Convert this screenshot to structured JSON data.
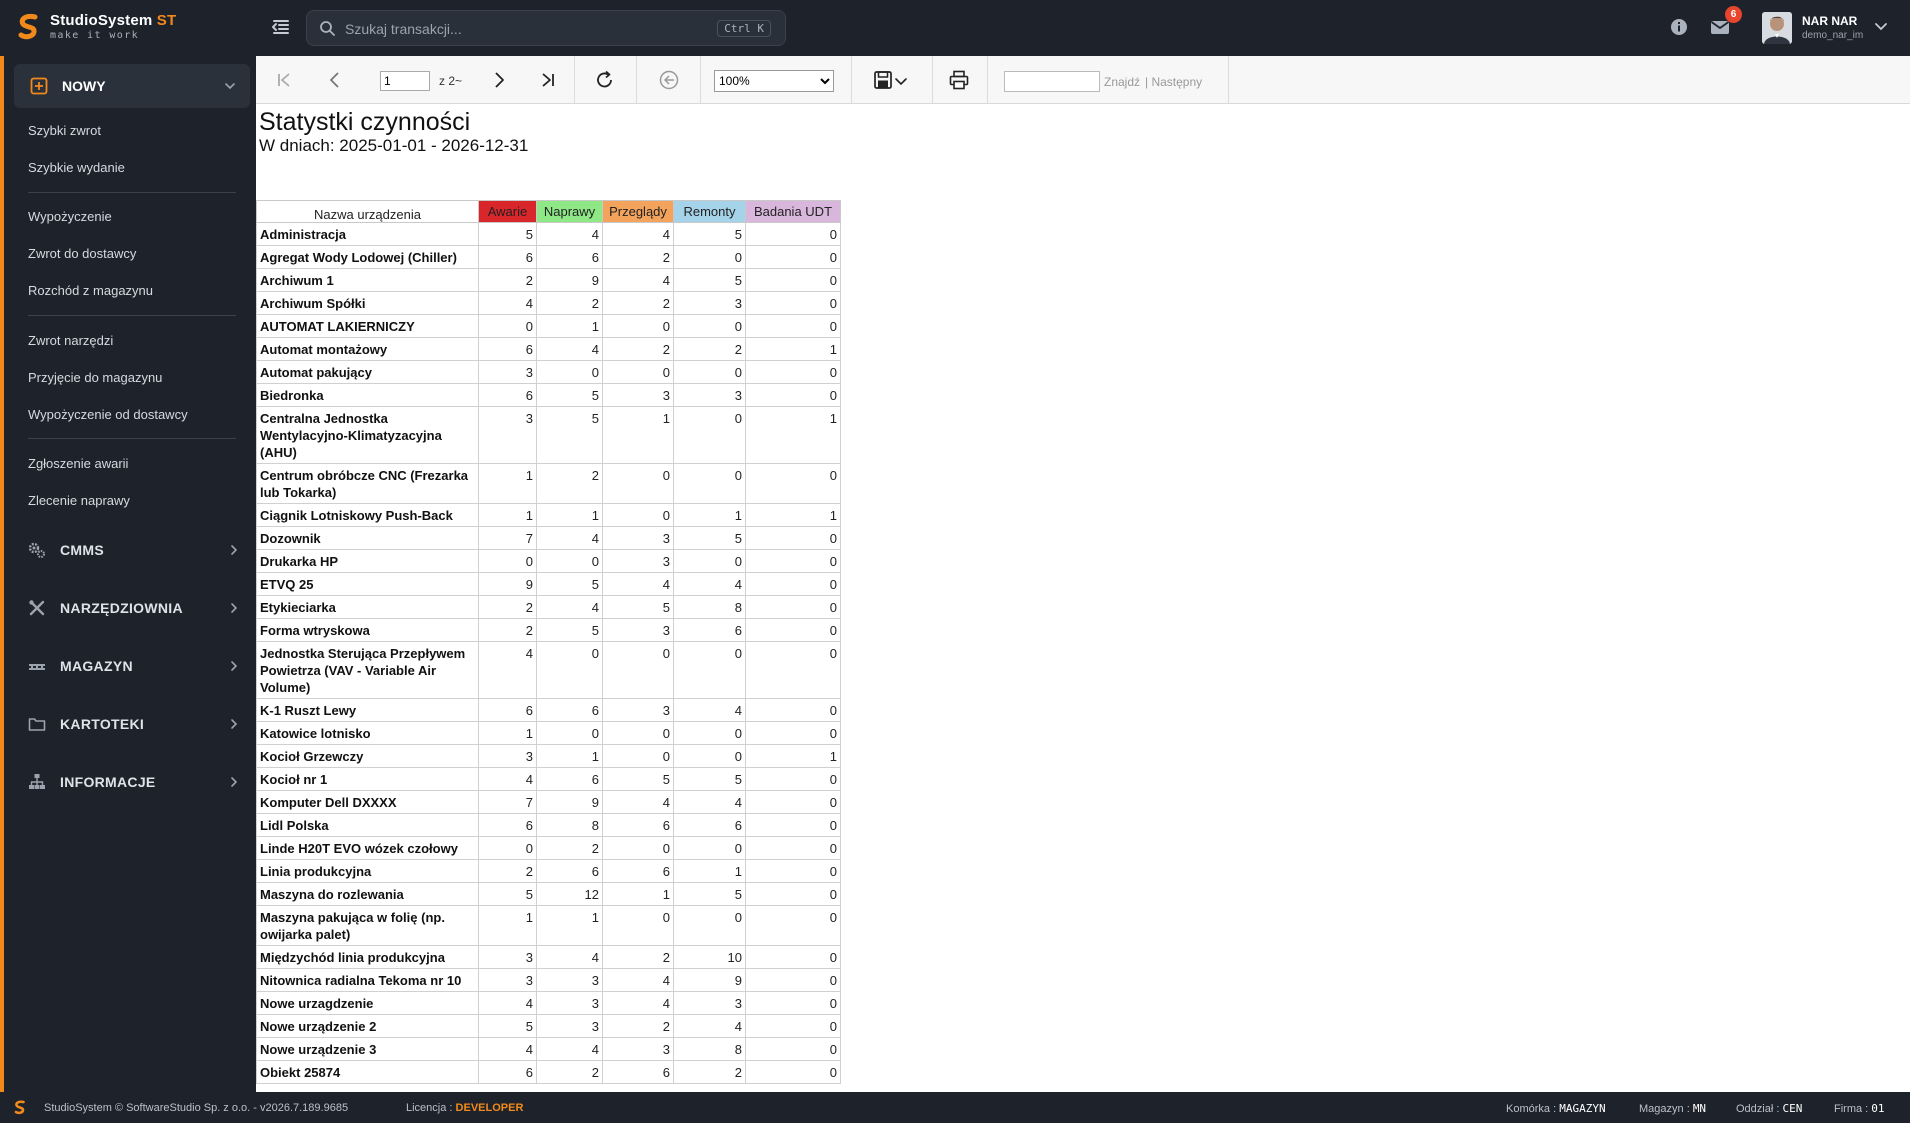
{
  "app": {
    "name": "StudioSystem",
    "name_suffix": "ST",
    "slogan": "make it work",
    "brand_color": "#f28a1b"
  },
  "header": {
    "search_placeholder": "Szukaj transakcji...",
    "search_shortcut": "Ctrl K",
    "notifications_count": "6",
    "user_name": "NAR NAR",
    "user_login": "demo_nar_im"
  },
  "sidebar": {
    "active_section": "NOWY",
    "sub_items": [
      "Szybki zwrot",
      "Szybkie wydanie",
      "Wypożyczenie",
      "Zwrot do dostawcy",
      "Rozchód z magazynu",
      "Zwrot narzędzi",
      "Przyjęcie do magazynu",
      "Wypożyczenie od dostawcy",
      "Zgłoszenie awarii",
      "Zlecenie naprawy"
    ],
    "sections": [
      "CMMS",
      "NARZĘDZIOWNIA",
      "MAGAZYN",
      "KARTOTEKI",
      "INFORMACJE"
    ]
  },
  "toolbar": {
    "page_value": "1",
    "page_of": "z 2~",
    "zoom": "100%",
    "find_label": "Znajdź",
    "next_label": "| Następny"
  },
  "report": {
    "title": "Statystki czynności",
    "subtitle": "W dniach: 2025-01-01 - 2026-12-31",
    "col_name": "Nazwa urządzenia",
    "columns": [
      {
        "label": "Awarie",
        "color": "#d9262a"
      },
      {
        "label": "Naprawy",
        "color": "#8ee886"
      },
      {
        "label": "Przeglądy",
        "color": "#f3a35c"
      },
      {
        "label": "Remonty",
        "color": "#a5d3ea"
      },
      {
        "label": "Badania UDT",
        "color": "#d9b7dd"
      }
    ],
    "rows": [
      {
        "name": "Administracja",
        "values": [
          5,
          4,
          4,
          5,
          0
        ]
      },
      {
        "name": "Agregat Wody Lodowej (Chiller)",
        "values": [
          6,
          6,
          2,
          0,
          0
        ]
      },
      {
        "name": "Archiwum 1",
        "values": [
          2,
          9,
          4,
          5,
          0
        ]
      },
      {
        "name": "Archiwum Spółki",
        "values": [
          4,
          2,
          2,
          3,
          0
        ]
      },
      {
        "name": "AUTOMAT LAKIERNICZY",
        "values": [
          0,
          1,
          0,
          0,
          0
        ]
      },
      {
        "name": "Automat montażowy",
        "values": [
          6,
          4,
          2,
          2,
          1
        ]
      },
      {
        "name": "Automat pakujący",
        "values": [
          3,
          0,
          0,
          0,
          0
        ]
      },
      {
        "name": "Biedronka",
        "values": [
          6,
          5,
          3,
          3,
          0
        ]
      },
      {
        "name": "Centralna Jednostka Wentylacyjno-Klimatyzacyjna (AHU)",
        "values": [
          3,
          5,
          1,
          0,
          1
        ]
      },
      {
        "name": "Centrum obróbcze CNC (Frezarka lub Tokarka)",
        "values": [
          1,
          2,
          0,
          0,
          0
        ]
      },
      {
        "name": "Ciągnik Lotniskowy Push-Back",
        "values": [
          1,
          1,
          0,
          1,
          1
        ]
      },
      {
        "name": "Dozownik",
        "values": [
          7,
          4,
          3,
          5,
          0
        ]
      },
      {
        "name": "Drukarka HP",
        "values": [
          0,
          0,
          3,
          0,
          0
        ]
      },
      {
        "name": "ETVQ 25",
        "values": [
          9,
          5,
          4,
          4,
          0
        ]
      },
      {
        "name": "Etykieciarka",
        "values": [
          2,
          4,
          5,
          8,
          0
        ]
      },
      {
        "name": "Forma wtryskowa",
        "values": [
          2,
          5,
          3,
          6,
          0
        ]
      },
      {
        "name": "Jednostka Sterująca Przepływem Powietrza (VAV - Variable Air Volume)",
        "values": [
          4,
          0,
          0,
          0,
          0
        ]
      },
      {
        "name": "K-1 Ruszt Lewy",
        "values": [
          6,
          6,
          3,
          4,
          0
        ]
      },
      {
        "name": "Katowice lotnisko",
        "values": [
          1,
          0,
          0,
          0,
          0
        ]
      },
      {
        "name": "Kocioł Grzewczy",
        "values": [
          3,
          1,
          0,
          0,
          1
        ]
      },
      {
        "name": "Kocioł nr 1",
        "values": [
          4,
          6,
          5,
          5,
          0
        ]
      },
      {
        "name": "Komputer Dell DXXXX",
        "values": [
          7,
          9,
          4,
          4,
          0
        ]
      },
      {
        "name": "Lidl Polska",
        "values": [
          6,
          8,
          6,
          6,
          0
        ]
      },
      {
        "name": "Linde H20T EVO wózek czołowy",
        "values": [
          0,
          2,
          0,
          0,
          0
        ]
      },
      {
        "name": "Linia produkcyjna",
        "values": [
          2,
          6,
          6,
          1,
          0
        ]
      },
      {
        "name": "Maszyna do rozlewania",
        "values": [
          5,
          12,
          1,
          5,
          0
        ]
      },
      {
        "name": "Maszyna pakująca w folię (np. owijarka palet)",
        "values": [
          1,
          1,
          0,
          0,
          0
        ]
      },
      {
        "name": "Międzychód linia produkcyjna",
        "values": [
          3,
          4,
          2,
          10,
          0
        ]
      },
      {
        "name": "Nitownica radialna Tekoma nr 10",
        "values": [
          3,
          3,
          4,
          9,
          0
        ]
      },
      {
        "name": "Nowe urzagdzenie",
        "values": [
          4,
          3,
          4,
          3,
          0
        ]
      },
      {
        "name": "Nowe urządzenie 2",
        "values": [
          5,
          3,
          2,
          4,
          0
        ]
      },
      {
        "name": "Nowe urządzenie 3",
        "values": [
          4,
          4,
          3,
          8,
          0
        ]
      },
      {
        "name": "Obiekt 25874",
        "values": [
          6,
          2,
          6,
          2,
          0
        ]
      }
    ]
  },
  "statusbar": {
    "copyright": "StudioSystem © SoftwareStudio Sp. z o.o. - v2026.7.189.9685",
    "license_label": "Licencja :",
    "license_value": "DEVELOPER",
    "cell_label": "Komórka :",
    "cell_value": "MAGAZYN",
    "warehouse_label": "Magazyn :",
    "warehouse_value": "MN",
    "branch_label": "Oddział :",
    "branch_value": "CEN",
    "company_label": "Firma :",
    "company_value": "01"
  }
}
